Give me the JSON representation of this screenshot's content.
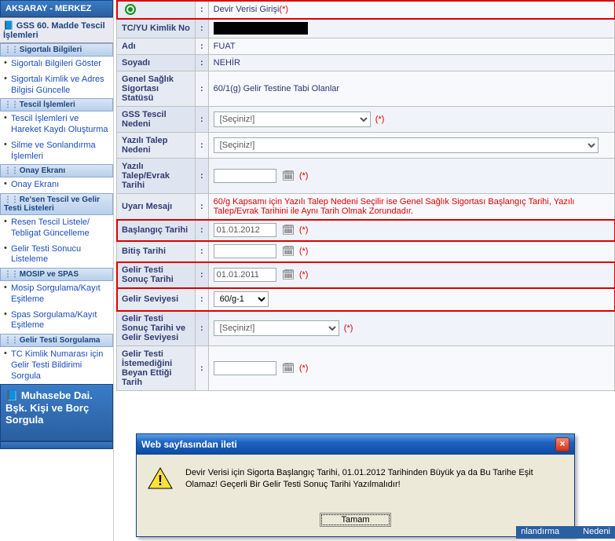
{
  "sidebar": {
    "top_user": "AKSARAY - MERKEZ",
    "module_title": "GSS 60. Madde Tescil İşlemleri",
    "sections": [
      {
        "header": "Sigortalı Bilgileri",
        "items": [
          "Sigortalı Bilgileri Göster",
          "Sigortalı Kimlik ve Adres Bilgisi Güncelle"
        ]
      },
      {
        "header": "Tescil İşlemleri",
        "items": [
          "Tescil İşlemleri ve Hareket Kaydı Oluşturma",
          "Silme ve Sonlandırma İşlemleri"
        ]
      },
      {
        "header": "Onay Ekranı",
        "items": [
          "Onay Ekranı"
        ]
      },
      {
        "header": "Re'sen Tescil ve Gelir Testi Listeleri",
        "items": [
          "Resen Tescil Listele/ Tebligat Güncelleme",
          "Gelir Testi Sonucu Listeleme"
        ]
      },
      {
        "header": "MOSIP ve SPAS",
        "items": [
          "Mosip Sorgulama/Kayıt Eşitleme",
          "Spas Sorgulama/Kayıt Eşitleme"
        ]
      },
      {
        "header": "Gelir Testi Sorgulama",
        "items": [
          "TC Kimlik Numarası için Gelir Testi Bildirimi Sorgula"
        ]
      }
    ],
    "bottom_module": "Muhasebe Dai. Bşk. Kişi ve Borç Sorgula"
  },
  "form": {
    "mode_label": "Devir Verisi Girişi",
    "rows": {
      "tcyu": {
        "label": "TC/YU Kimlik No"
      },
      "adi": {
        "label": "Adı",
        "value": "FUAT"
      },
      "soyadi": {
        "label": "Soyadı",
        "value": "NEHİR"
      },
      "gss_statu": {
        "label": "Genel Sağlık Sigortası Statüsü",
        "value": "60/1(g)    Gelir Testine Tabi Olanlar"
      },
      "tescil_nedeni": {
        "label": "GSS Tescil Nedeni",
        "placeholder": "[Seçiniz!]"
      },
      "talep_nedeni": {
        "label": "Yazılı Talep Nedeni",
        "placeholder": "[Seçiniz!]"
      },
      "talep_tarihi": {
        "label": "Yazılı Talep/Evrak Tarihi"
      },
      "uyari": {
        "label": "Uyarı Mesajı",
        "value": "60/g Kapsamı için Yazılı Talep Nedeni Seçilir ise Genel Sağlık Sigortası Başlangıç Tarihi, Yazılı Talep/Evrak Tarihini ile Aynı Tarih Olmak Zorundadır."
      },
      "baslangic": {
        "label": "Başlangıç Tarihi",
        "value": "01.01.2012"
      },
      "bitis": {
        "label": "Bitiş Tarihi",
        "value": ""
      },
      "gt_sonuc": {
        "label": "Gelir Testi Sonuç Tarihi",
        "value": "01.01.2011"
      },
      "gelir_seviyesi": {
        "label": "Gelir Seviyesi",
        "selected": "60/g-1"
      },
      "gt_sonuc_seviye": {
        "label": "Gelir Testi Sonuç Tarihi ve Gelir Seviyesi",
        "placeholder": "[Seçiniz!]"
      },
      "istemedi": {
        "label": "Gelir Testi İstemediğini Beyan Ettiği Tarih",
        "value": ""
      }
    },
    "required_marker": "(*)",
    "colon": ":"
  },
  "dialog": {
    "title": "Web sayfasından ileti",
    "message": "Devir Verisi için Sigorta Başlangıç Tarihi, 01.01.2012 Tarihinden Büyük ya da Bu Tarihe Eşit Olamaz! Geçerli Bir Gelir Testi Sonuç Tarihi Yazılmalıdır!",
    "ok": "Tamam"
  },
  "bottom_strip": {
    "a": "nlandırma",
    "b": "  Nedeni"
  },
  "icons": {
    "calendar": "🗓",
    "close": "×",
    "book": "📘"
  }
}
